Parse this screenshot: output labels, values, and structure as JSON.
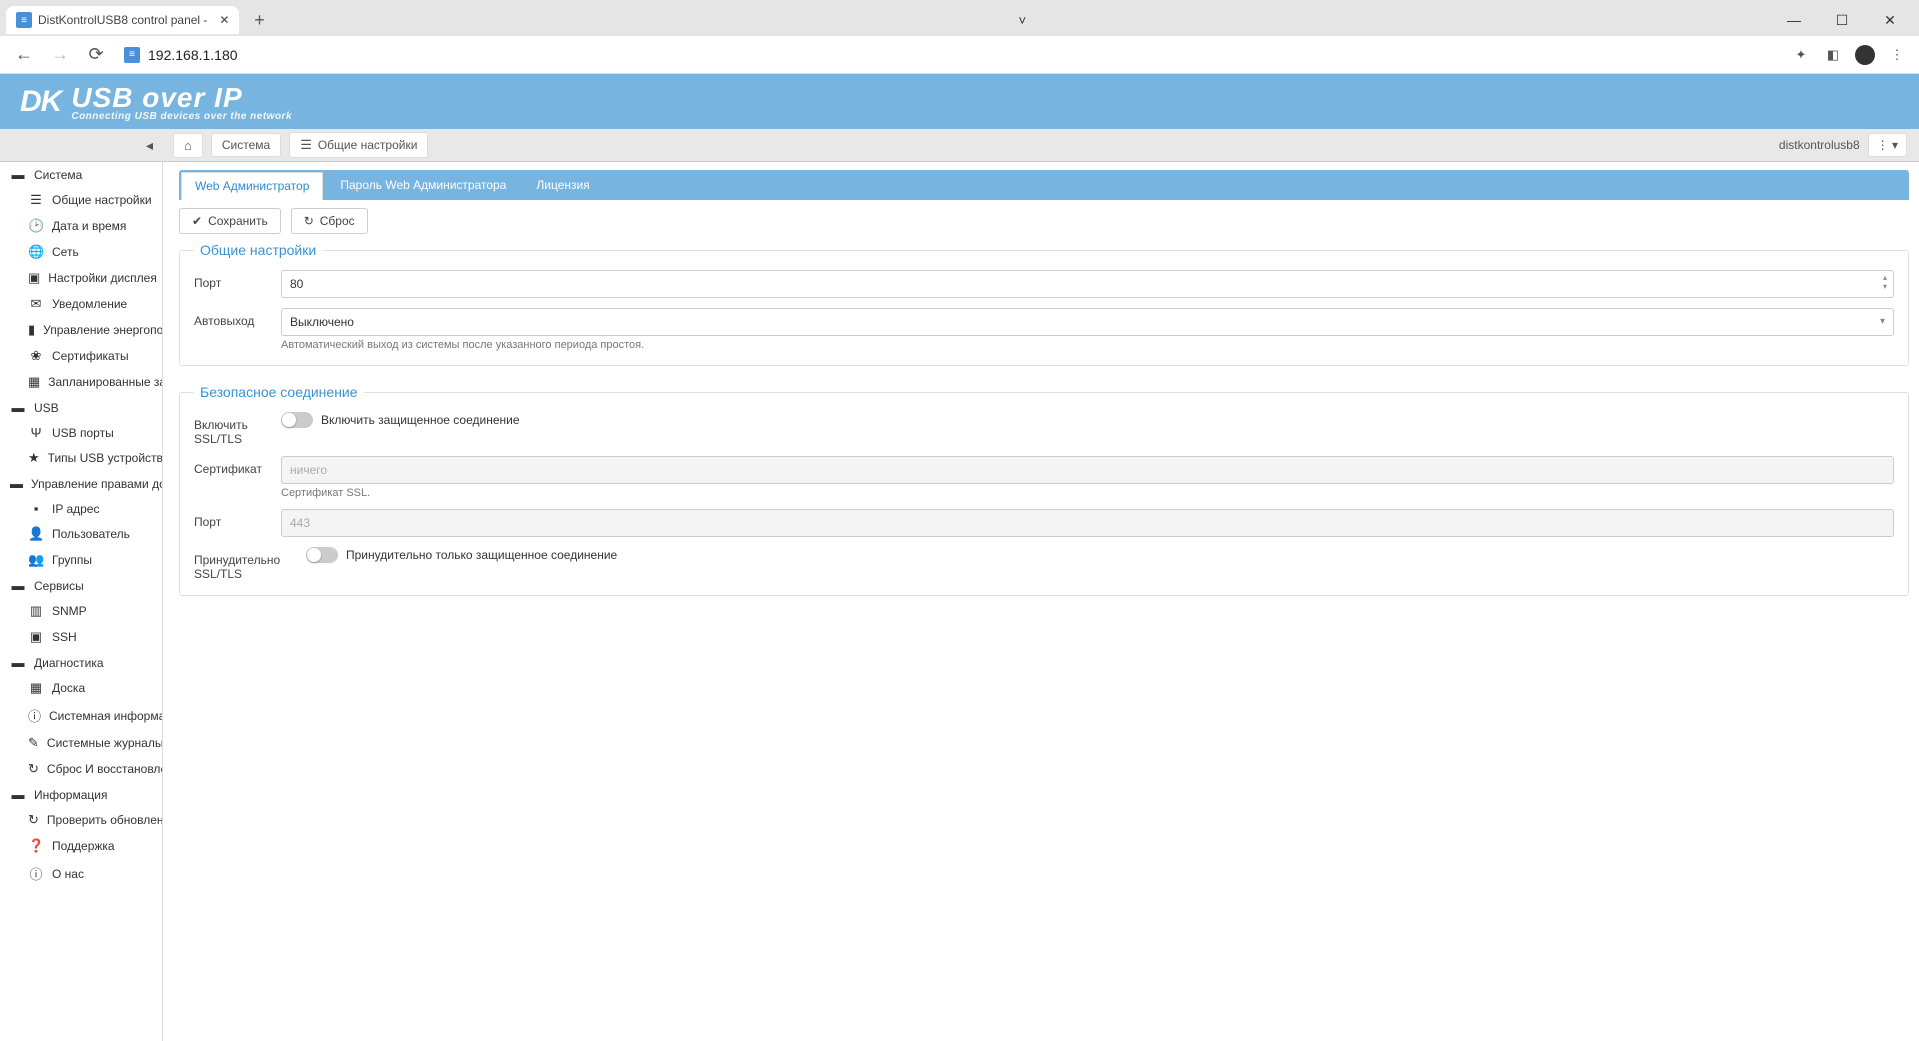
{
  "browser": {
    "tab_title": "DistKontrolUSB8 control panel -",
    "url": "192.168.1.180"
  },
  "banner": {
    "brand": "DK",
    "title": "USB over IP",
    "subtitle": "Connecting USB devices over the network"
  },
  "breadcrumbs": {
    "system": "Система",
    "general_settings": "Общие настройки"
  },
  "user": "distkontrolusb8",
  "sidebar": {
    "system": "Система",
    "general_settings": "Общие настройки",
    "date_time": "Дата и время",
    "network": "Сеть",
    "display_settings": "Настройки дисплея",
    "notification": "Уведомление",
    "power_management": "Управление энергопотреблением",
    "certificates": "Сертификаты",
    "scheduled_tasks": "Запланированные задания",
    "usb": "USB",
    "usb_ports": "USB порты",
    "usb_device_types": "Типы USB устройств",
    "access_management": "Управление правами доступа",
    "ip_address": "IP адрес",
    "user_item": "Пользователь",
    "groups": "Группы",
    "services": "Сервисы",
    "snmp": "SNMP",
    "ssh": "SSH",
    "diagnostics": "Диагностика",
    "dashboard": "Доска",
    "system_info": "Системная информация",
    "system_logs": "Системные журналы",
    "reset_restore": "Сброс И восстановление",
    "information": "Информация",
    "check_updates": "Проверить обновления",
    "support": "Поддержка",
    "about": "О нас"
  },
  "tabs": {
    "web_admin": "Web Администратор",
    "web_admin_password": "Пароль Web Администратора",
    "license": "Лицензия"
  },
  "actions": {
    "save": "Сохранить",
    "reset": "Сброс"
  },
  "form": {
    "general": {
      "legend": "Общие настройки",
      "port_label": "Порт",
      "port_value": "80",
      "autologout_label": "Автовыход",
      "autologout_value": "Выключено",
      "autologout_hint": "Автоматический выход из системы после указанного периода простоя."
    },
    "secure": {
      "legend": "Безопасное соединение",
      "enable_label": "Включить SSL/TLS",
      "enable_toggle_text": "Включить защищенное соединение",
      "cert_label": "Сертификат",
      "cert_placeholder": "ничего",
      "cert_hint": "Сертификат SSL.",
      "port_label": "Порт",
      "port_value": "443",
      "force_label": "Принудительно SSL/TLS",
      "force_toggle_text": "Принудительно только защищенное соединение"
    }
  }
}
